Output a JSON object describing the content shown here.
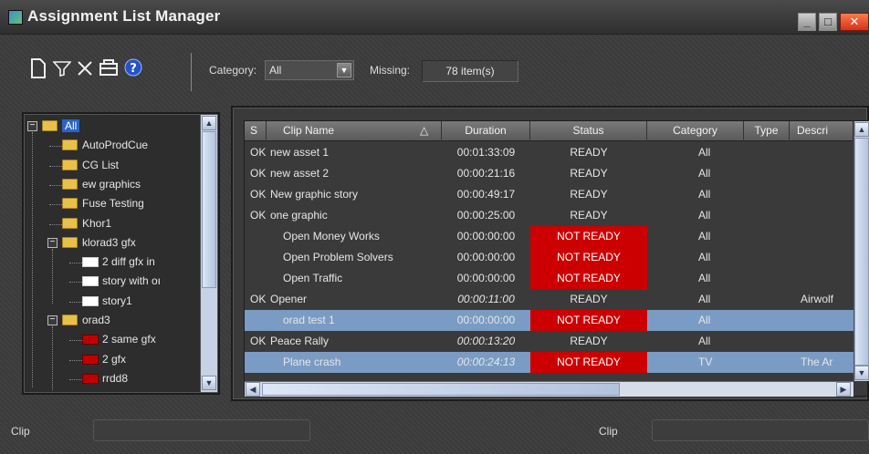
{
  "window": {
    "title": "Assignment List Manager",
    "minimize": "_",
    "maximize": "□",
    "close": "✕"
  },
  "toolbar": {
    "icons": [
      "new-document-icon",
      "filter-icon",
      "delete-icon",
      "inbox-icon",
      "help-icon"
    ],
    "category_label": "Category:",
    "category_value": "All",
    "missing_label": "Missing:",
    "missing_value": "78 item(s)"
  },
  "tree": {
    "items": [
      {
        "label": "All",
        "type": "folder",
        "level": 0,
        "expanded": true,
        "selected": true
      },
      {
        "label": "AutoProdCue",
        "type": "folder",
        "level": 1
      },
      {
        "label": "CG List",
        "type": "folder",
        "level": 1
      },
      {
        "label": "ew graphics",
        "type": "folder",
        "level": 1
      },
      {
        "label": "Fuse Testing",
        "type": "folder",
        "level": 1
      },
      {
        "label": "Khor1",
        "type": "folder",
        "level": 1
      },
      {
        "label": "klorad3 gfx",
        "type": "folder",
        "level": 1,
        "expanded": true
      },
      {
        "label": "2 diff gfx in",
        "type": "doc",
        "level": 2
      },
      {
        "label": "story with oı",
        "type": "doc",
        "level": 2
      },
      {
        "label": "story1",
        "type": "doc",
        "level": 2
      },
      {
        "label": "orad3",
        "type": "folder",
        "level": 1,
        "expanded": true
      },
      {
        "label": "2 same gfx",
        "type": "doc-red",
        "level": 2
      },
      {
        "label": "2 gfx",
        "type": "doc-red",
        "level": 2
      },
      {
        "label": "rrdd8",
        "type": "doc-red",
        "level": 2
      }
    ]
  },
  "grid": {
    "columns": [
      "S",
      "Clip Name",
      "Duration",
      "Status",
      "Category",
      "Type",
      "Descri"
    ],
    "sort_indicator": "△",
    "rows": [
      {
        "s": "OK",
        "name": "new asset 1",
        "duration": "00:01:33:09",
        "status": "READY",
        "category": "All",
        "type": "",
        "desc": "",
        "italic": false,
        "selected": false
      },
      {
        "s": "OK",
        "name": "new asset 2",
        "duration": "00:00:21:16",
        "status": "READY",
        "category": "All",
        "type": "",
        "desc": "",
        "italic": false,
        "selected": false
      },
      {
        "s": "OK",
        "name": "New graphic story",
        "duration": "00:00:49:17",
        "status": "READY",
        "category": "All",
        "type": "",
        "desc": "",
        "italic": false,
        "selected": false
      },
      {
        "s": "OK",
        "name": "one graphic",
        "duration": "00:00:25:00",
        "status": "READY",
        "category": "All",
        "type": "",
        "desc": "",
        "italic": false,
        "selected": false
      },
      {
        "s": "",
        "name": "Open Money Works",
        "duration": "00:00:00:00",
        "status": "NOT READY",
        "category": "All",
        "type": "",
        "desc": "",
        "italic": false,
        "selected": false
      },
      {
        "s": "",
        "name": "Open Problem Solvers",
        "duration": "00:00:00:00",
        "status": "NOT READY",
        "category": "All",
        "type": "",
        "desc": "",
        "italic": false,
        "selected": false
      },
      {
        "s": "",
        "name": "Open Traffic",
        "duration": "00:00:00:00",
        "status": "NOT READY",
        "category": "All",
        "type": "",
        "desc": "",
        "italic": false,
        "selected": false
      },
      {
        "s": "OK",
        "name": "Opener",
        "duration": "00:00:11:00",
        "status": "READY",
        "category": "All",
        "type": "",
        "desc": "Airwolf",
        "italic": true,
        "selected": false
      },
      {
        "s": "",
        "name": "orad test 1",
        "duration": "00:00:00:00",
        "status": "NOT READY",
        "category": "All",
        "type": "",
        "desc": "",
        "italic": false,
        "selected": true
      },
      {
        "s": "OK",
        "name": "Peace Rally",
        "duration": "00:00:13:20",
        "status": "READY",
        "category": "All",
        "type": "",
        "desc": "",
        "italic": true,
        "selected": false
      },
      {
        "s": "",
        "name": "Plane crash",
        "duration": "00:00:24:13",
        "status": "NOT READY",
        "category": "TV",
        "type": "",
        "desc": "The Ar",
        "italic": true,
        "selected": true
      }
    ]
  },
  "statusbar": {
    "left_label": "Clip",
    "right_label": "Clip"
  },
  "colors": {
    "not_ready": "#cc0000",
    "selection": "#7a9cc4",
    "tree_selection": "#2a63c7"
  }
}
